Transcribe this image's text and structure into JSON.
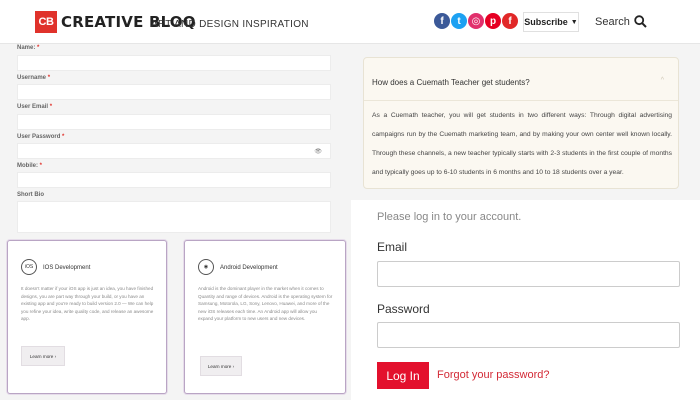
{
  "header": {
    "logo_mark": "CB",
    "logo_word": "CREATIVE BLOQ",
    "tagline": "ART AND DESIGN INSPIRATION",
    "socials": [
      {
        "name": "facebook-icon",
        "glyph": "f",
        "color": "#3b5998"
      },
      {
        "name": "twitter-icon",
        "glyph": "t",
        "color": "#1da1f2"
      },
      {
        "name": "instagram-icon",
        "glyph": "◎",
        "color": "#e1306c"
      },
      {
        "name": "pinterest-icon",
        "glyph": "p",
        "color": "#e60023"
      },
      {
        "name": "flipboard-icon",
        "glyph": "f",
        "color": "#e12828"
      }
    ],
    "subscribe_label": "Subscribe",
    "subscribe_caret": "▼",
    "search_label": "Search"
  },
  "form": {
    "name_label": "Name:",
    "username_label": "Username",
    "email_label": "User Email",
    "password_label": "User Password",
    "password_toggle": "👁",
    "mobile_label": "Mobile:",
    "bio_label": "Short Bio",
    "required_mark": "*"
  },
  "cards": [
    {
      "icon_text": "iOS",
      "title": "IOS Development",
      "desc": "It doesn't matter if your iOS app is just an idea, you have finished designs, you are part way through your build, or you have an existing app and you're ready to build version 2.0 — We can help you refine your idea, write quality code, and release an awesome app.",
      "button": "Learn more ›"
    },
    {
      "icon_text": "◉",
      "title": "Android Development",
      "desc": "Android is the dominant player in the market when it comes to Quantity and range of devices. Android is the operating system for Samsung, Motorola, LG, Sony, Lenovo, Huawei, and more of the new iOS releases each time. An Android app will allow you expand your platform to new users and new devices.",
      "button": "Learn more ›"
    }
  ],
  "faq": {
    "question": "How does a Cuemath Teacher get students?",
    "toggle": "^",
    "answer": "As a Cuemath teacher, you will get students in two different ways: Through digital advertising campaigns run by the Cuemath marketing team, and by making your own center well known locally. Through these channels, a new teacher typically starts with 2-3 students in the first couple of months and typically goes up to 6-10 students in 6 months and 10 to 18 students over a year."
  },
  "login": {
    "hint": "Please log in to your account.",
    "email_label": "Email",
    "password_label": "Password",
    "login_button": "Log In",
    "forgot_link": "Forgot your password?"
  }
}
